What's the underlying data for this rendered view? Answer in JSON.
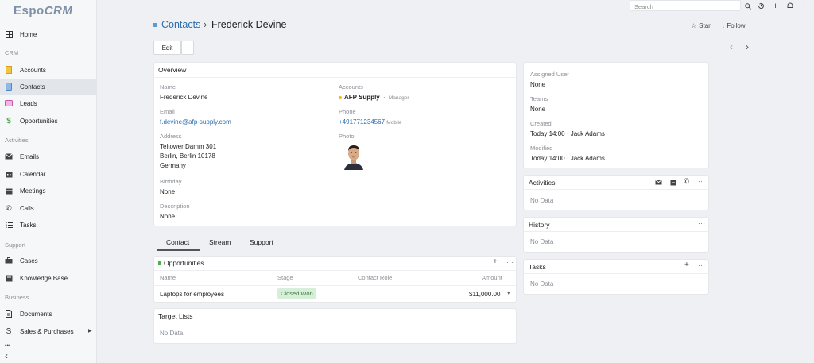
{
  "app": {
    "logo_part1": "Espo",
    "logo_part2": "CRM"
  },
  "sidebar": {
    "home": "Home",
    "section_crm": "CRM",
    "accounts": "Accounts",
    "contacts": "Contacts",
    "leads": "Leads",
    "opportunities": "Opportunities",
    "section_activities": "Activities",
    "emails": "Emails",
    "calendar": "Calendar",
    "meetings": "Meetings",
    "calls": "Calls",
    "tasks": "Tasks",
    "section_support": "Support",
    "cases": "Cases",
    "knowledge_base": "Knowledge Base",
    "section_business": "Business",
    "documents": "Documents",
    "sales_purchases": "Sales & Purchases",
    "more": "•••",
    "collapse": "‹"
  },
  "topbar": {
    "search_placeholder": "Search"
  },
  "header": {
    "breadcrumb_parent": "Contacts",
    "separator": "›",
    "record_name": "Frederick Devine",
    "star_label": "Star",
    "follow_label": "Follow"
  },
  "toolbar": {
    "edit_label": "Edit",
    "more_label": "···",
    "prev": "‹",
    "next": "›"
  },
  "overview": {
    "title": "Overview",
    "name_label": "Name",
    "name_value": "Frederick Devine",
    "accounts_label": "Accounts",
    "account_name": "AFP Supply",
    "account_sep": "·",
    "account_role": "Manager",
    "email_label": "Email",
    "email_value": "f.devine@afp-supply.com",
    "phone_label": "Phone",
    "phone_value": "+491771234567",
    "phone_type": "Mobile",
    "address_label": "Address",
    "address_line1": "Teltower Damm 301",
    "address_line2": "Berlin, Berlin 10178",
    "address_line3": "Germany",
    "photo_label": "Photo",
    "birthday_label": "Birthday",
    "birthday_value": "None",
    "description_label": "Description",
    "description_value": "None"
  },
  "tabs": [
    "Contact",
    "Stream",
    "Support"
  ],
  "opportunities": {
    "title": "Opportunities",
    "columns": [
      "Name",
      "Stage",
      "Contact Role",
      "Amount"
    ],
    "rows": [
      {
        "name": "Laptops for employees",
        "stage": "Closed Won",
        "role": "",
        "amount": "$11,000.00"
      }
    ]
  },
  "target_lists": {
    "title": "Target Lists",
    "empty": "No Data"
  },
  "side": {
    "assigned_user_label": "Assigned User",
    "assigned_user_value": "None",
    "teams_label": "Teams",
    "teams_value": "None",
    "created_label": "Created",
    "created_value": "Today 14:00",
    "created_by": "Jack Adams",
    "modified_label": "Modified",
    "modified_value": "Today 14:00",
    "modified_by": "Jack Adams",
    "dot_sep": "·"
  },
  "activities": {
    "title": "Activities",
    "empty": "No Data"
  },
  "history": {
    "title": "History",
    "empty": "No Data"
  },
  "tasks": {
    "title": "Tasks",
    "empty": "No Data"
  },
  "colors": {
    "link": "#2b6cb0",
    "accent_blue": "#5b9bd5",
    "badge_bg": "#d7efd8",
    "account_dot": "#f0b429"
  }
}
